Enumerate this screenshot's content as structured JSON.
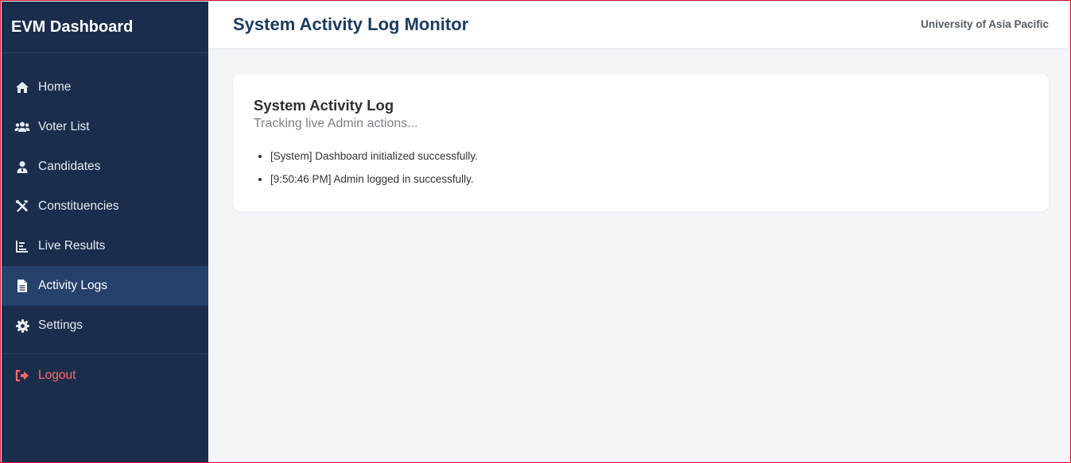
{
  "sidebar": {
    "brand": "EVM Dashboard",
    "items": [
      {
        "label": "Home",
        "icon": "home-icon"
      },
      {
        "label": "Voter List",
        "icon": "users-icon"
      },
      {
        "label": "Candidates",
        "icon": "user-tie-icon"
      },
      {
        "label": "Constituencies",
        "icon": "tools-icon"
      },
      {
        "label": "Live Results",
        "icon": "chart-icon"
      },
      {
        "label": "Activity Logs",
        "icon": "file-icon",
        "active": true
      },
      {
        "label": "Settings",
        "icon": "gear-icon"
      }
    ],
    "logout": {
      "label": "Logout",
      "icon": "sign-out-icon",
      "color": "#ff6b6b"
    }
  },
  "header": {
    "title": "System Activity Log Monitor",
    "org": "University of Asia Pacific"
  },
  "card": {
    "title": "System Activity Log",
    "subtitle": "Tracking live Admin actions...",
    "logs": [
      "[System] Dashboard initialized successfully.",
      "[9:50:46 PM] Admin logged in successfully."
    ]
  },
  "colors": {
    "sidebar_bg": "#1b2d4c",
    "sidebar_active": "#26416a",
    "accent_title": "#1b3b5f",
    "logout": "#ff6b6b",
    "page_bg": "#f4f5f9"
  }
}
